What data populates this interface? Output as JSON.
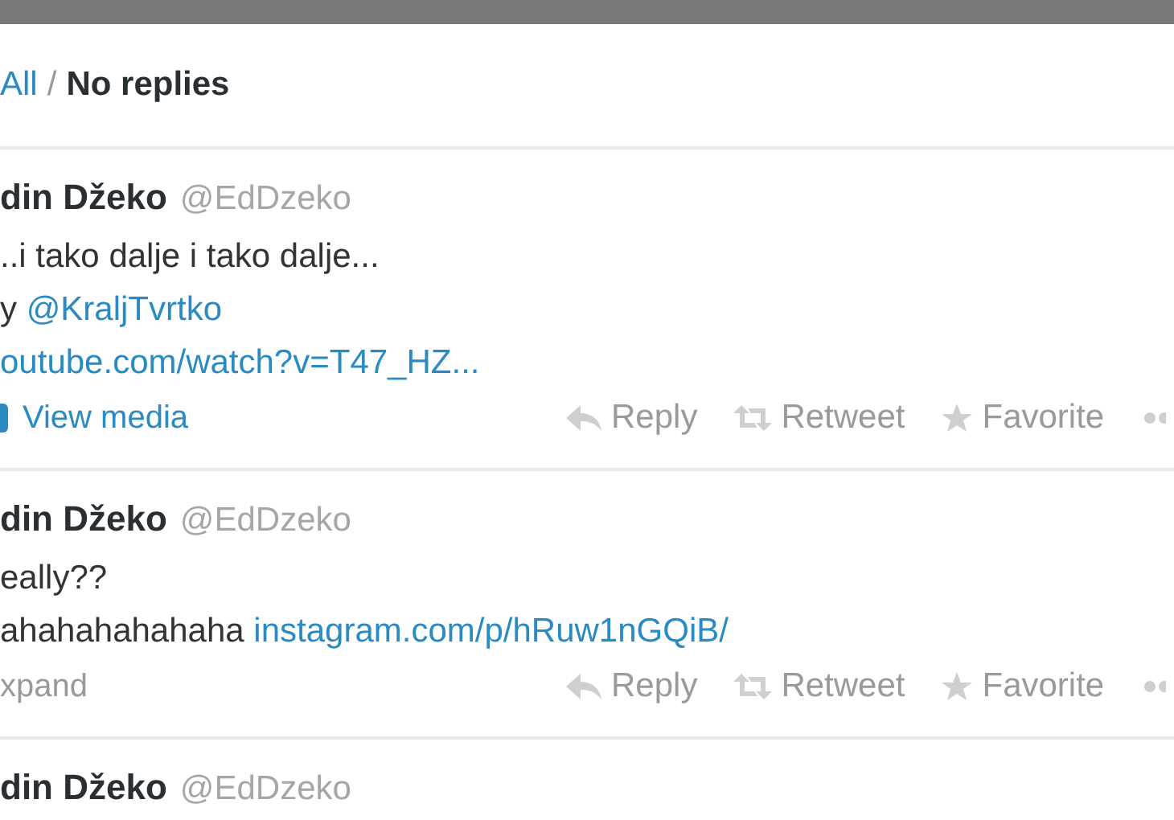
{
  "filter": {
    "options": [
      {
        "label": "All",
        "selected": false
      },
      {
        "label": "No replies",
        "selected": true
      }
    ],
    "separator": "/"
  },
  "tweets": [
    {
      "name": "din Džeko",
      "handle": "@EdDzeko",
      "lines": [
        [
          {
            "text": "..i tako dalje i tako dalje...",
            "link": false
          }
        ],
        [
          {
            "text": "y ",
            "link": false
          },
          {
            "text": "@KraljTvrtko",
            "link": true
          }
        ],
        [
          {
            "text": "outube.com/watch?v=T47_HZ...",
            "link": true
          }
        ]
      ],
      "footer": {
        "kind": "media",
        "label": "View media"
      },
      "actions": [
        "Reply",
        "Retweet",
        "Favorite"
      ]
    },
    {
      "name": "din Džeko",
      "handle": "@EdDzeko",
      "lines": [
        [
          {
            "text": "eally??",
            "link": false
          }
        ],
        [
          {
            "text": "ahahahahahaha ",
            "link": false
          },
          {
            "text": "instagram.com/p/hRuw1nGQiB/",
            "link": true
          }
        ]
      ],
      "footer": {
        "kind": "expand",
        "label": "xpand"
      },
      "actions": [
        "Reply",
        "Retweet",
        "Favorite"
      ]
    },
    {
      "name": "din Džeko",
      "handle": "@EdDzeko"
    }
  ]
}
